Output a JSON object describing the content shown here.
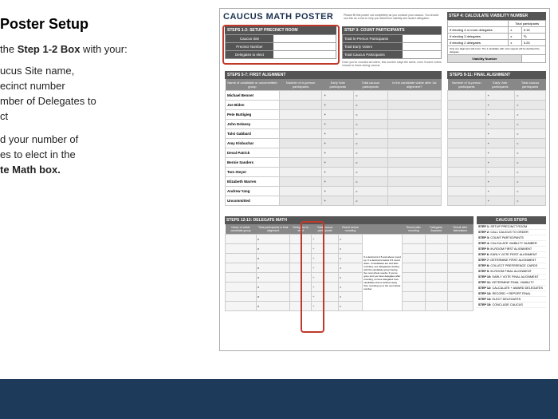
{
  "left": {
    "title": "Poster Setup",
    "p1_a": "the ",
    "p1_b": "Step 1-2 Box",
    "p1_c": " with your:",
    "b1": "ucus Site name,",
    "b2": "ecinct number",
    "b3": "mber of Delegates to",
    "b4": "ct",
    "p2_a": "d your number of",
    "p2_b": "es to elect in the",
    "p2_c": "te Math box."
  },
  "poster": {
    "title": "CAUCUS MATH POSTER",
    "subtitle": "Please fill this poster out completely as you conduct your caucus. You should use this as a tool to help you determine viability and award delegates.",
    "step12_header": "STEPS 1-2: SETUP PRECINCT ROOM",
    "setup_rows": [
      "Caucus Site",
      "Precinct Number",
      "Delegates to elect"
    ],
    "step3_header": "STEP 3: COUNT PARTICIPANTS",
    "step3_rows": [
      "Total In-Person Participants",
      "Total Early Voters",
      "Total Caucus Participants"
    ],
    "step3_note": "Once you've counted all voters, this number stays the same, even if some voters choose to leave during caucus.",
    "step4_header": "STEP 4: CALCULATE VIABILITY NUMBER",
    "step4_col": "Total participants",
    "step4_rows": [
      {
        "a": "If electing 4 or more delegates",
        "b": "x",
        "c": "0.15"
      },
      {
        "a": "If electing 3 delegates",
        "b": "x",
        "c": "⅙"
      },
      {
        "a": "If electing 2 delegates",
        "b": "x",
        "c": "0.25"
      }
    ],
    "step4_note": "Only one alignment will occur. The 1 candidate with most support will be declared the delegate.",
    "viability_label": "Viability Number",
    "first_align_header": "STEPS 5-7: FIRST ALIGNMENT",
    "first_cols": [
      "Name of candidate or uncommitted group",
      "Number of in-person participants",
      "Early Vote participants",
      "Total caucus participants",
      "Is the candidate viable after 1st alignment?"
    ],
    "candidates": [
      "Michael Bennet",
      "Joe Biden",
      "Pete Buttigieg",
      "John Delaney",
      "Tulsi Gabbard",
      "Amy Klobuchar",
      "Deval Patrick",
      "Bernie Sanders",
      "Tom Steyer",
      "Elizabeth Warren",
      "Andrew Yang",
      "Uncommitted"
    ],
    "final_header": "STEPS 9-11: FINAL ALIGNMENT",
    "final_cols": [
      "Number of in-person participants",
      "Early Vote participants",
      "Total caucus participants"
    ],
    "delegate_header": "STEPS 12-13: DELEGATE MATH",
    "delegate_cols": [
      "Name of viable candidate group",
      "Total participants in final alignment",
      "Delegates to elect",
      "Total caucus participants",
      "Result before rounding",
      "",
      "Result after rounding",
      "Delegates Awarded",
      "Result after tiebreakers"
    ],
    "delegate_mid": "If a decimal is 0.5 and above round up. If a decimal is below 0.5 round down. If candidates are tied after rounding, see delegate(s) starting with the candidate group having the most whole results. If you've gone and you have delegates after rounding, remove delegates from candidates that is farthest away from rounding up to the next whole number.",
    "steps_header": "CAUCUS STEPS",
    "steps": [
      "STEP 1: SETUP PRECINCT ROOM",
      "STEP 2: CALL CAUCUS TO ORDER",
      "STEP 3: COUNT PARTICIPANTS",
      "STEP 4: CALCULATE VIABILITY NUMBER",
      "STEP 5: IN-ROOM FIRST ALIGNMENT",
      "STEP 6: EARLY VOTE FIRST ALIGNMENT",
      "STEP 7: DETERMINE FIRST ALIGNMENT",
      "STEP 8: COLLECT PREFERENCE CARDS",
      "STEP 9: IN-ROOM FINAL ALIGNMENT",
      "STEP 10: EARLY VOTE FINAL ALIGNMENT",
      "STEP 11: DETERMINE FINAL VIABILITY",
      "STEP 12: CALCULATE + AWARD DELEGATES",
      "STEP 13: RECORD + REPORT FINAL",
      "STEP 14: ELECT DELEGATES",
      "STEP 15: CONCLUDE CAUCUS"
    ]
  }
}
